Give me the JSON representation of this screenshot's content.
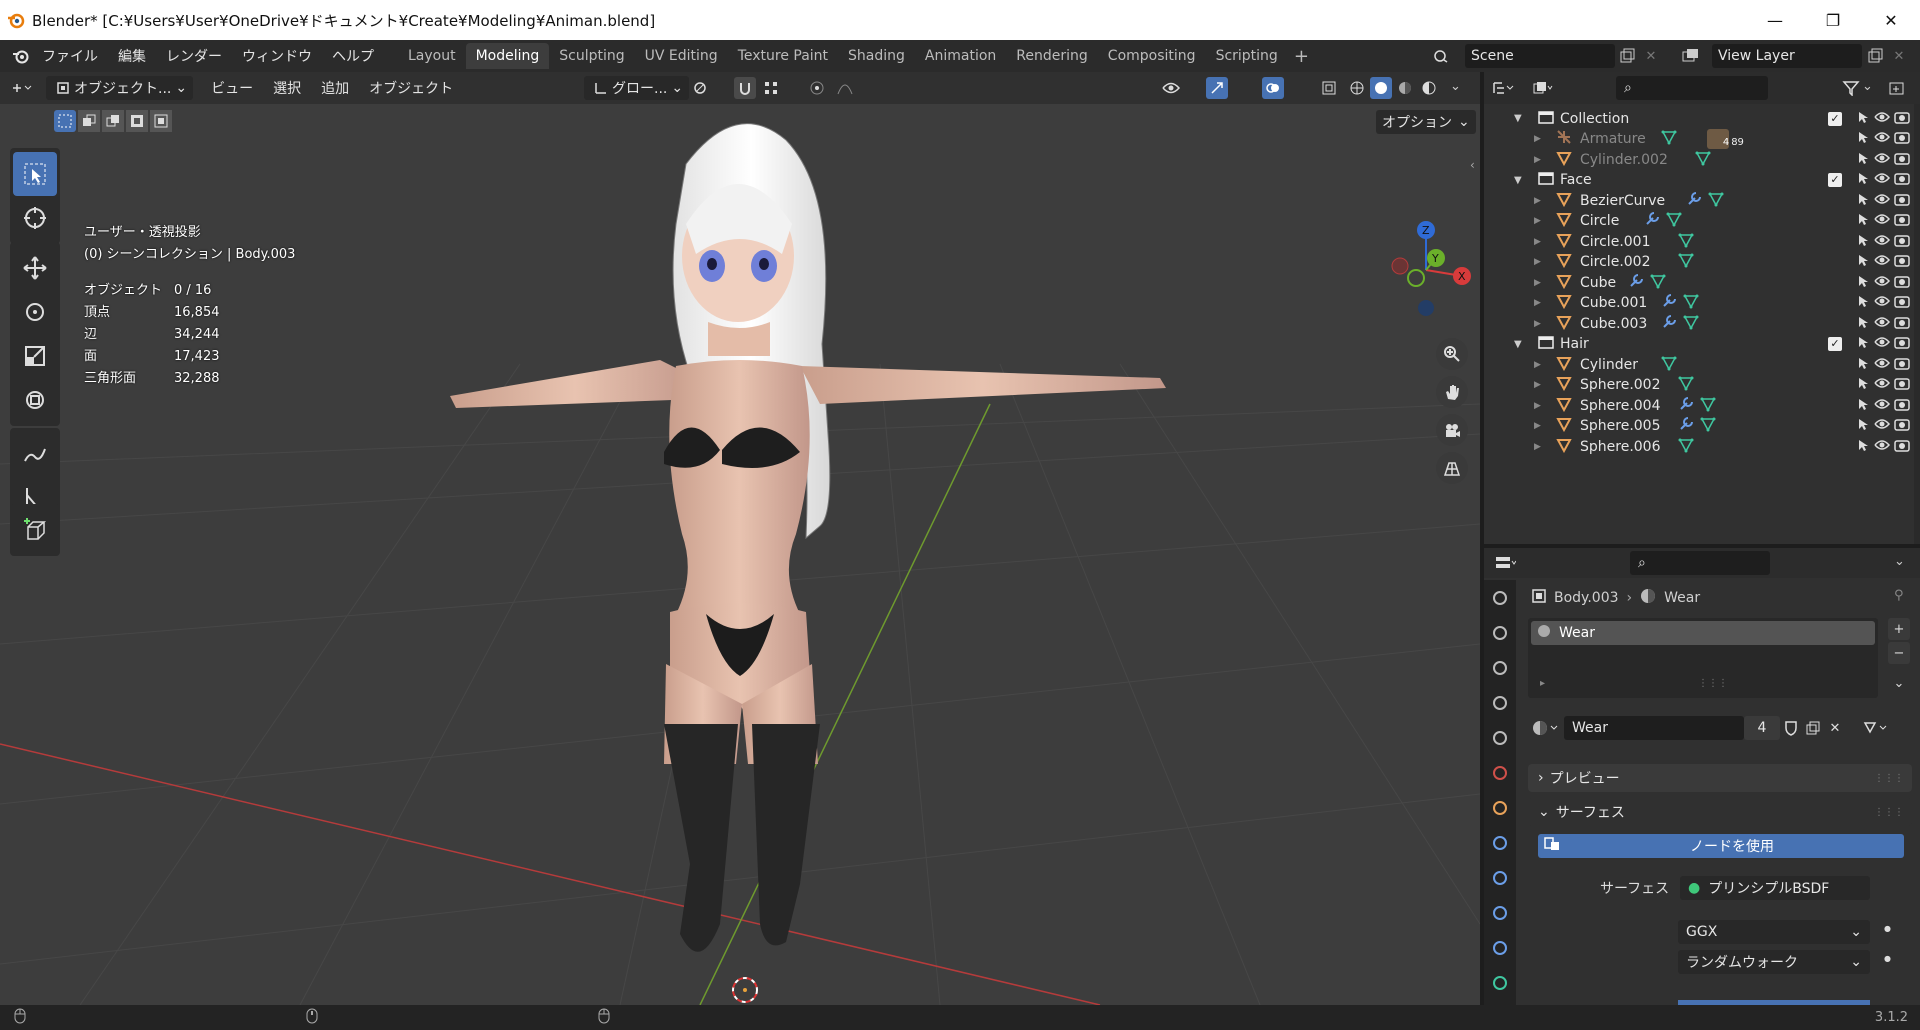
{
  "window": {
    "title": "Blender* [C:¥Users¥User¥OneDrive¥ドキュメント¥Create¥Modeling¥Animan.blend]",
    "minimize": "—",
    "maximize": "❐",
    "close": "✕"
  },
  "menu": [
    "ファイル",
    "編集",
    "レンダー",
    "ウィンドウ",
    "ヘルプ"
  ],
  "workspaces": [
    "Layout",
    "Modeling",
    "Sculpting",
    "UV Editing",
    "Texture Paint",
    "Shading",
    "Animation",
    "Rendering",
    "Compositing",
    "Scripting"
  ],
  "active_workspace": "Modeling",
  "scene": {
    "label": "Scene",
    "view_layer": "View Layer"
  },
  "viewport_header": {
    "mode": "オブジェクト...",
    "view": "ビュー",
    "select": "選択",
    "add": "追加",
    "object": "オブジェクト",
    "transform": "グロー...",
    "options": "オプション"
  },
  "viewport_info": {
    "projection": "ユーザー・透視投影",
    "collection": "(0) シーンコレクション | Body.003"
  },
  "stats": [
    {
      "label": "オブジェクト",
      "value": "0 / 16"
    },
    {
      "label": "頂点",
      "value": "16,854"
    },
    {
      "label": "辺",
      "value": "34,244"
    },
    {
      "label": "面",
      "value": "17,423"
    },
    {
      "label": "三角形面",
      "value": "32,288"
    }
  ],
  "gizmo": {
    "z": "Z",
    "y": "Y",
    "x": "X"
  },
  "outliner": {
    "rows": [
      {
        "name": "Collection",
        "type": "collection",
        "indent": 0,
        "expanded": true
      },
      {
        "name": "Armature",
        "type": "armature",
        "indent": 1,
        "dim": true,
        "badge1": "4",
        "badge2": "89"
      },
      {
        "name": "Cylinder.002",
        "type": "mesh",
        "indent": 1,
        "dim": true
      },
      {
        "name": "Face",
        "type": "collection",
        "indent": 0,
        "expanded": true
      },
      {
        "name": "BezierCurve",
        "type": "mesh",
        "indent": 1,
        "mod": true
      },
      {
        "name": "Circle",
        "type": "mesh",
        "indent": 1,
        "mod": true
      },
      {
        "name": "Circle.001",
        "type": "mesh",
        "indent": 1
      },
      {
        "name": "Circle.002",
        "type": "mesh",
        "indent": 1
      },
      {
        "name": "Cube",
        "type": "mesh",
        "indent": 1,
        "mod": true
      },
      {
        "name": "Cube.001",
        "type": "mesh",
        "indent": 1,
        "mod": true
      },
      {
        "name": "Cube.003",
        "type": "mesh",
        "indent": 1,
        "mod": true
      },
      {
        "name": "Hair",
        "type": "collection",
        "indent": 0,
        "expanded": true
      },
      {
        "name": "Cylinder",
        "type": "mesh",
        "indent": 1
      },
      {
        "name": "Sphere.002",
        "type": "mesh",
        "indent": 1
      },
      {
        "name": "Sphere.004",
        "type": "mesh",
        "indent": 1,
        "mod": true
      },
      {
        "name": "Sphere.005",
        "type": "mesh",
        "indent": 1,
        "mod": true
      },
      {
        "name": "Sphere.006",
        "type": "mesh",
        "indent": 1
      }
    ]
  },
  "properties": {
    "breadcrumb_object": "Body.003",
    "breadcrumb_material": "Wear",
    "slot_name": "Wear",
    "material_name": "Wear",
    "users": "4",
    "preview_label": "プレビュー",
    "surface_label": "サーフェス",
    "use_nodes": "ノードを使用",
    "surface_field_label": "サーフェス",
    "surface_value": "プリンシプルBSDF",
    "distribution": "GGX",
    "subsurface": "ランダムウォーク"
  },
  "status": {
    "version": "3.1.2"
  },
  "colors": {
    "accent": "#4772b3",
    "mesh": "#e8a25a",
    "mod": "#6b9ee8",
    "data": "#3fc7a0"
  }
}
